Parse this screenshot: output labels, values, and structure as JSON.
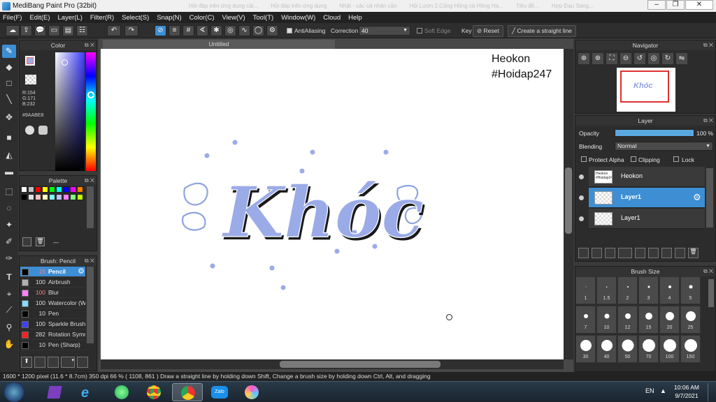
{
  "window": {
    "title": "MediBang Paint Pro (32bit)",
    "ghost_tabs": [
      "Hỏi đáp trên ứng dụng cài...",
      "Hỏi đáp trên ứng dụng",
      "Nhật - các cá nhân cần",
      "Hỏi Lượn 2.Công Hồng cả Hồng Ha...",
      "Tiêu đề...",
      "Hợp Đau Sáng..."
    ]
  },
  "menu": [
    "File(F)",
    "Edit(E)",
    "Layer(L)",
    "Filter(R)",
    "Select(S)",
    "Snap(N)",
    "Color(C)",
    "View(V)",
    "Tool(T)",
    "Window(W)",
    "Cloud",
    "Help"
  ],
  "toolbar": {
    "antialiasing": "AntiAliasing",
    "correction_label": "Correction",
    "correction_value": "40",
    "soft_edge": "Soft Edge",
    "key": "Key",
    "reset": "Reset",
    "straight_line": "Create a straight line"
  },
  "color_panel": {
    "title": "Color",
    "r": "R:154",
    "g": "G:171",
    "b": "B:232",
    "hex": "#9AABE8",
    "primary": "#9aabe8"
  },
  "palette": {
    "title": "Palette",
    "swatches": [
      "#ffffff",
      "#c0c0c0",
      "#ff0000",
      "#ffff00",
      "#00ff00",
      "#00ffff",
      "#0000ff",
      "#ff00ff",
      "#ff8000",
      "#000000",
      "#e0e0e0",
      "#ffc0c0",
      "#ffffc0",
      "#80ffff",
      "#c0c0ff",
      "#ff80ff",
      "#80ff80",
      "#c0ff00"
    ],
    "dash": "---"
  },
  "brush_panel": {
    "title": "Brush: Pencil",
    "items": [
      {
        "size": "15",
        "name": "Pencil",
        "color": "#000000"
      },
      {
        "size": "100",
        "name": "Airbrush",
        "color": "#b0b0b0"
      },
      {
        "size": "100",
        "name": "Blur",
        "color": "#ff80ff"
      },
      {
        "size": "100",
        "name": "Watercolor (W",
        "color": "#80e0ff"
      },
      {
        "size": "10",
        "name": "Pen",
        "color": "#000000"
      },
      {
        "size": "100",
        "name": "Sparkle Brush",
        "color": "#4040ff"
      },
      {
        "size": "282",
        "name": "Rotation Symm",
        "color": "#ff2020"
      },
      {
        "size": "10",
        "name": "Pen (Sharp)",
        "color": "#000000"
      }
    ]
  },
  "document": {
    "tab": "Untitled",
    "watermark_line1": "Heokon",
    "watermark_line2": "#Hoidap247",
    "art_text": "Khóc",
    "art_color": "#9aabe8"
  },
  "navigator": {
    "title": "Navigator",
    "thumb_text": "Khóc"
  },
  "layer_panel": {
    "title": "Layer",
    "opacity_label": "Opacity",
    "opacity_value": "100 %",
    "blending_label": "Blending",
    "blending_value": "Normal",
    "protect_alpha": "Protect Alpha",
    "clipping": "Clipping",
    "lock": "Lock",
    "layers": [
      {
        "name": "Heokon",
        "thumb": "Heokon #Hoidap247"
      },
      {
        "name": "Layer1"
      },
      {
        "name": "Layer1"
      }
    ]
  },
  "brush_size": {
    "title": "Brush Size",
    "sizes": [
      "1",
      "1.5",
      "2",
      "3",
      "4",
      "5",
      "7",
      "10",
      "12",
      "15",
      "20",
      "25",
      "30",
      "40",
      "50",
      "70",
      "100",
      "150"
    ]
  },
  "status": "1600 * 1200 pixel  (11.6 * 8.7cm)  350 dpi  66 %  ( 1108, 861 )  Draw a straight line by holding down Shift, Change a brush size by holding down Ctrl, Alt, and dragging",
  "taskbar": {
    "lang": "EN",
    "time": "10:06 AM",
    "date": "9/7/2021",
    "apps": [
      "windows-start",
      "visual-studio",
      "internet-explorer",
      "google-earth",
      "chrome",
      "chrome-active",
      "zalo",
      "medibang"
    ],
    "zalo_label": "Zalo"
  }
}
